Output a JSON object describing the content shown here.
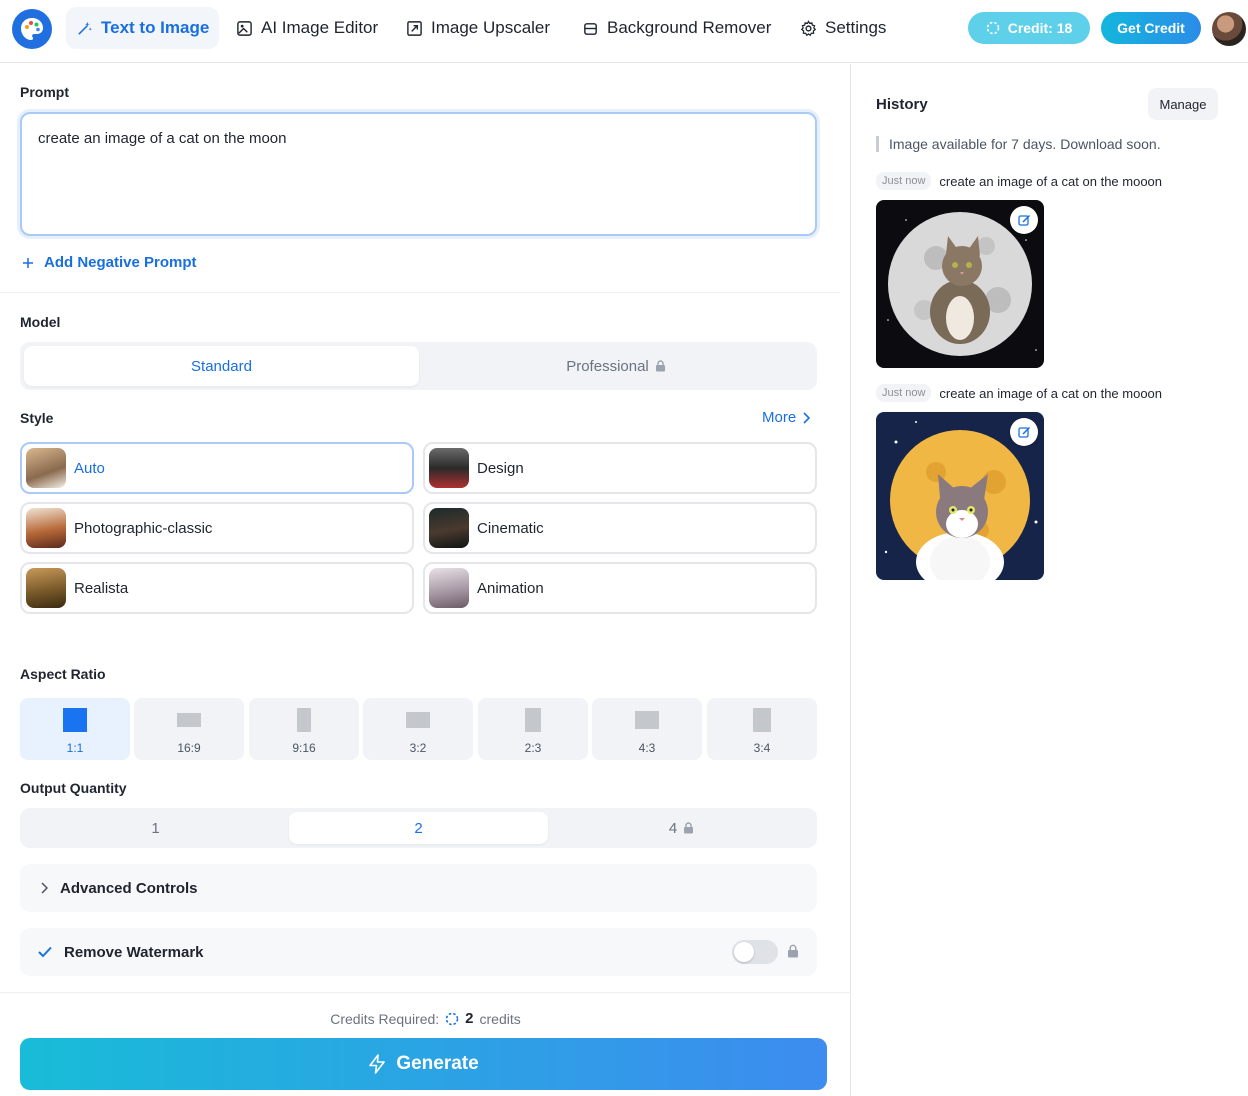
{
  "nav": {
    "items": [
      {
        "label": "Text to Image",
        "icon": "magic-wand-icon",
        "active": true
      },
      {
        "label": "AI Image Editor",
        "icon": "image-edit-icon",
        "active": false
      },
      {
        "label": "Image Upscaler",
        "icon": "expand-icon",
        "active": false
      },
      {
        "label": "Background Remover",
        "icon": "eraser-icon",
        "active": false
      },
      {
        "label": "Settings",
        "icon": "gear-icon",
        "active": false
      }
    ],
    "credit_label": "Credit: 18",
    "get_credit_label": "Get Credit"
  },
  "prompt": {
    "label": "Prompt",
    "value": "create an image of a cat on the moon",
    "negative_label": "Add Negative Prompt"
  },
  "model": {
    "label": "Model",
    "options": [
      "Standard",
      "Professional"
    ],
    "selected": "Standard"
  },
  "style": {
    "label": "Style",
    "more_label": "More",
    "options": [
      "Auto",
      "Design",
      "Photographic-classic",
      "Cinematic",
      "Realista",
      "Animation"
    ],
    "selected": "Auto"
  },
  "aspect_ratio": {
    "label": "Aspect Ratio",
    "options": [
      "1:1",
      "16:9",
      "9:16",
      "3:2",
      "2:3",
      "4:3",
      "3:4"
    ],
    "selected": "1:1"
  },
  "output_quantity": {
    "label": "Output Quantity",
    "options": [
      "1",
      "2",
      "4"
    ],
    "selected": "2"
  },
  "advanced_label": "Advanced Controls",
  "watermark": {
    "label": "Remove Watermark",
    "enabled": false
  },
  "credits_required": {
    "label": "Credits Required:",
    "value": "2",
    "unit": "credits"
  },
  "generate_label": "Generate",
  "history": {
    "title": "History",
    "manage_label": "Manage",
    "note": "Image available for 7 days. Download soon.",
    "items": [
      {
        "time": "Just now",
        "prompt": "create an image of a cat on the mooon"
      },
      {
        "time": "Just now",
        "prompt": "create an image of a cat on the mooon"
      }
    ]
  },
  "colors": {
    "accent": "#1a6fe0",
    "credit_pill": "#5fd0ea"
  }
}
